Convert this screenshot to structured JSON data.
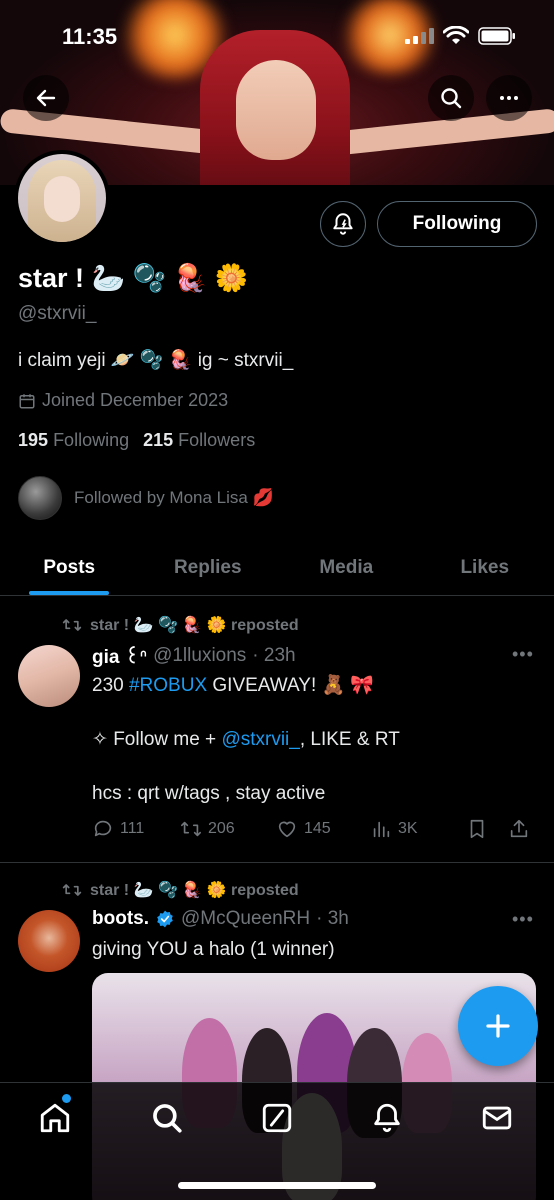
{
  "status_bar": {
    "time": "11:35"
  },
  "profile": {
    "display_name": "star ! 🦢 🫧 🪼 🌼",
    "handle": "@stxrvii_",
    "bio": "i claim yeji 🪐 🫧 🪼 ig ~ stxrvii_",
    "joined": "Joined December 2023",
    "following_count": "195",
    "following_label": "Following",
    "followers_count": "215",
    "followers_label": "Followers",
    "followed_by": "Followed by Mona Lisa 💋",
    "follow_button": "Following"
  },
  "tabs": [
    {
      "label": "Posts",
      "active": true
    },
    {
      "label": "Replies",
      "active": false
    },
    {
      "label": "Media",
      "active": false
    },
    {
      "label": "Likes",
      "active": false
    }
  ],
  "posts": [
    {
      "repost_label": "star ! 🦢 🫧 🪼 🌼 reposted",
      "name": "gia ꒰ᐢ",
      "handle": "@1lluxions",
      "time": "· 23h",
      "text_line1_prefix": "230 ",
      "text_line1_link": "#ROBUX",
      "text_line1_suffix": " GIVEAWAY! 🧸 🎀",
      "text_line2_prefix": "✧ Follow me + ",
      "text_line2_link": "@stxrvii_",
      "text_line2_suffix": ", LIKE & RT",
      "text_line3": "hcs : qrt w/tags , stay active",
      "replies": "111",
      "reposts": "206",
      "likes": "145",
      "views": "3K"
    },
    {
      "repost_label": "star ! 🦢 🫧 🪼 🌼 reposted",
      "name": "boots.",
      "handle": "@McQueenRH",
      "time": "· 3h",
      "text": "giving YOU a halo (1 winner)"
    }
  ],
  "colors": {
    "accent": "#1d9bf0",
    "muted": "#71767b",
    "divider": "#2f3336"
  }
}
